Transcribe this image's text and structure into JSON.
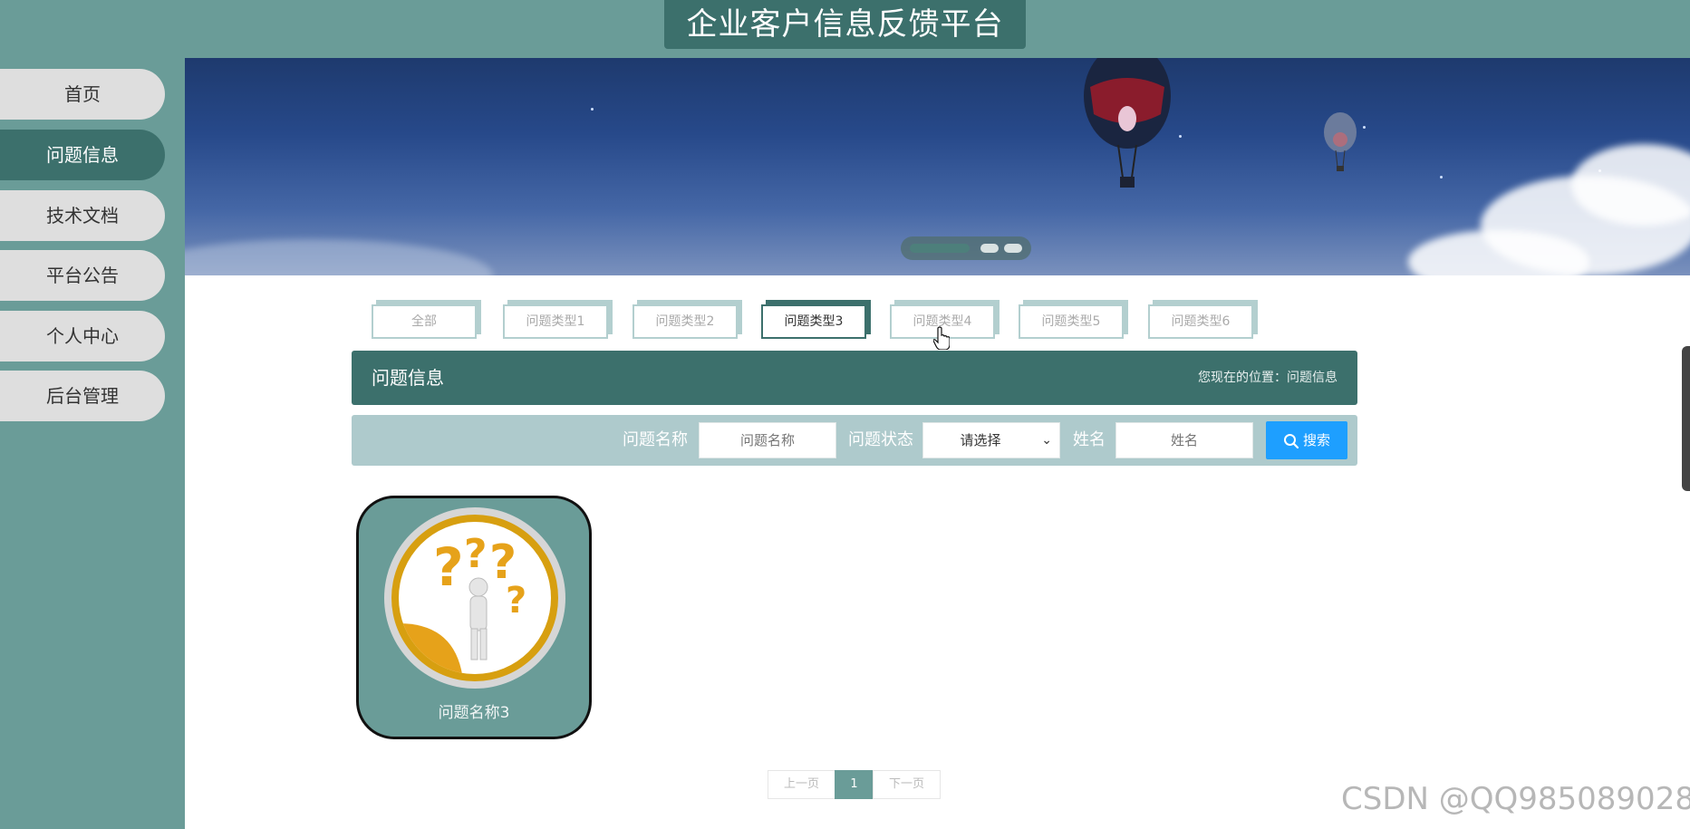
{
  "header": {
    "title": "企业客户信息反馈平台"
  },
  "sidebar": {
    "items": [
      {
        "label": "首页",
        "active": false
      },
      {
        "label": "问题信息",
        "active": true
      },
      {
        "label": "技术文档",
        "active": false
      },
      {
        "label": "平台公告",
        "active": false
      },
      {
        "label": "个人中心",
        "active": false
      },
      {
        "label": "后台管理",
        "active": false
      }
    ]
  },
  "tabs": [
    "全部",
    "问题类型1",
    "问题类型2",
    "问题类型3",
    "问题类型4",
    "问题类型5",
    "问题类型6"
  ],
  "active_tab": "问题类型3",
  "section": {
    "title": "问题信息",
    "location_label": "您现在的位置：",
    "location_value": "问题信息"
  },
  "search": {
    "name_label": "问题名称",
    "name_placeholder": "问题名称",
    "status_label": "问题状态",
    "status_value": "请选择",
    "person_label": "姓名",
    "person_placeholder": "姓名",
    "button_label": "搜索"
  },
  "cards": [
    {
      "title": "问题名称3"
    }
  ],
  "pagination": {
    "prev": "上一页",
    "current": "1",
    "next": "下一页"
  },
  "watermark": "CSDN @QQ985089028",
  "colors": {
    "primary": "#3c706c",
    "sidebar": "#6a9c98",
    "search_bg": "#aecacc",
    "search_button": "#1e9fff"
  },
  "icons": {
    "search_button": "search-icon",
    "banner": "hot-air-balloon-icon"
  }
}
